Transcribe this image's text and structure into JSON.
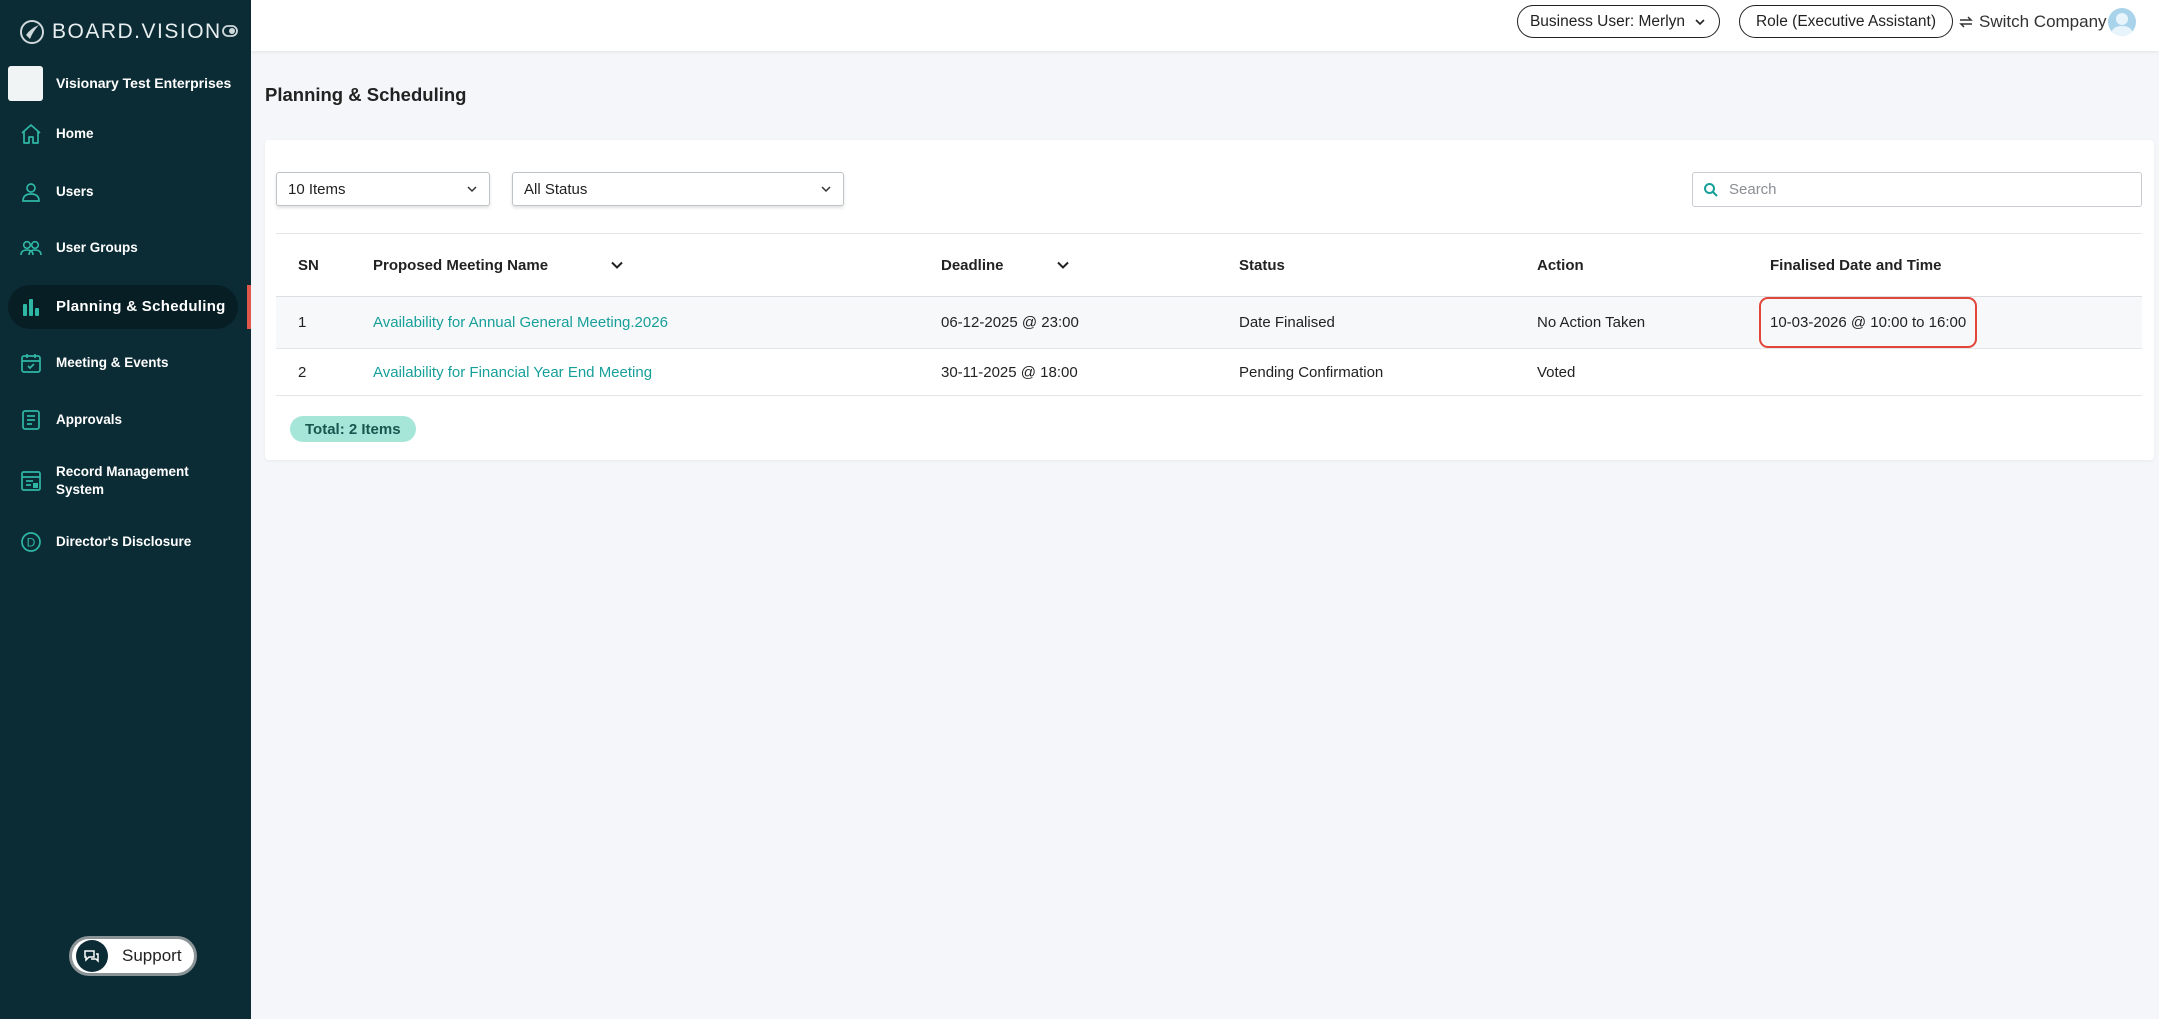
{
  "sidebar": {
    "brand": "BOARD.VISION",
    "company": "Visionary Test Enterprises",
    "items": [
      {
        "label": "Home",
        "icon": "home-icon"
      },
      {
        "label": "Users",
        "icon": "user-icon"
      },
      {
        "label": "User Groups",
        "icon": "user-group-icon"
      },
      {
        "label": "Planning & Scheduling",
        "icon": "bar-chart-icon"
      },
      {
        "label": "Meeting & Events",
        "icon": "calendar-icon"
      },
      {
        "label": "Approvals",
        "icon": "document-icon"
      },
      {
        "label": "Record Management System",
        "icon": "record-icon"
      },
      {
        "label": "Director's Disclosure",
        "icon": "disclosure-d-icon"
      }
    ],
    "support_label": "Support"
  },
  "topbar": {
    "business_user": "Business User: Merlyn",
    "role": "Role (Executive Assistant)",
    "switch_company": "Switch Company"
  },
  "page": {
    "title": "Planning & Scheduling",
    "items_select": "10 Items",
    "status_select": "All Status",
    "search_placeholder": "Search",
    "total": "Total: 2 Items"
  },
  "table": {
    "headers": [
      "SN",
      "Proposed Meeting Name",
      "Deadline",
      "Status",
      "Action",
      "Finalised Date and Time"
    ],
    "rows": [
      {
        "sn": "1",
        "name": "Availability for Annual General Meeting.2026",
        "deadline": "06-12-2025 @ 23:00",
        "status": "Date Finalised",
        "action": "No Action Taken",
        "finalised": "10-03-2026 @ 10:00 to 16:00"
      },
      {
        "sn": "2",
        "name": "Availability for Financial Year End Meeting",
        "deadline": "30-11-2025 @ 18:00",
        "status": "Pending Confirmation",
        "action": "Voted",
        "finalised": ""
      }
    ]
  },
  "colors": {
    "sidebar_bg": "#0c2c35",
    "accent": "#17a09a",
    "highlight": "#e2453a",
    "active_marker": "#e2574c"
  }
}
